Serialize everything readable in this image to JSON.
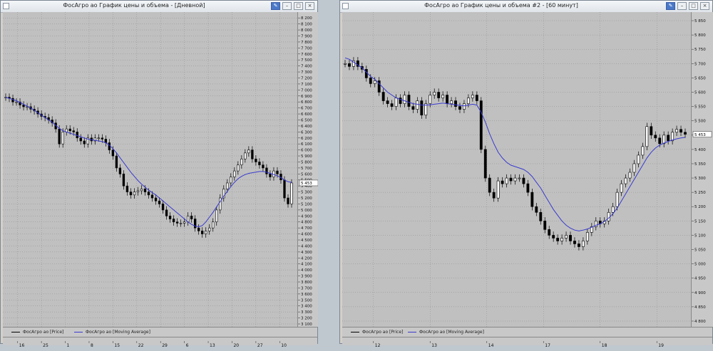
{
  "windows": [
    {
      "title": "ФосАгро ао График цены и объема - [Дневной]",
      "legend": [
        "ФосАгро ао [Price]",
        "ФосАгро ао [Moving Average]"
      ]
    },
    {
      "title": "ФосАгро ао График цены и объема #2 - [60 минут]",
      "legend": [
        "ФосАгро ао [Price]",
        "ФосАгро ао [Moving Average]"
      ]
    }
  ],
  "colors": {
    "price": "#000000",
    "moving_average": "#3a3ad0",
    "background": "#c0c0c0",
    "grid": "#8c8c8c"
  },
  "chart_data": [
    {
      "type": "line",
      "title": "ФосАгро ао График цены и объема - [Дневной]",
      "y_ticks": [
        3100,
        3200,
        3300,
        3400,
        3500,
        3600,
        3700,
        3800,
        3900,
        4000,
        4100,
        4200,
        4300,
        4400,
        4500,
        4600,
        4700,
        4800,
        4900,
        5000,
        5100,
        5200,
        5300,
        5400,
        5500,
        5600,
        5700,
        5800,
        5900,
        6000,
        6100,
        6200,
        6300,
        6400,
        6500,
        6600,
        6700,
        6800,
        6900,
        7000,
        7100,
        7200,
        7300,
        7400,
        7500,
        7600,
        7700,
        7800,
        7900,
        8000,
        8100,
        8200
      ],
      "ylim": [
        3100,
        8250
      ],
      "x_ticks": [
        "16",
        "25",
        "1",
        "8",
        "15",
        "22",
        "29",
        "6",
        "13",
        "20",
        "27",
        "10"
      ],
      "last_price_label": "5 453",
      "grid": true,
      "series": [
        {
          "name": "ФосАгро ао [Price]",
          "values": [
            6880,
            6860,
            6800,
            6800,
            6750,
            6720,
            6720,
            6680,
            6650,
            6600,
            6560,
            6540,
            6500,
            6450,
            6350,
            6100,
            6300,
            6350,
            6320,
            6300,
            6200,
            6150,
            6100,
            6200,
            6150,
            6200,
            6200,
            6180,
            6120,
            6000,
            5900,
            5700,
            5600,
            5400,
            5300,
            5250,
            5300,
            5320,
            5350,
            5300,
            5250,
            5200,
            5150,
            5100,
            5000,
            4900,
            4850,
            4800,
            4780,
            4780,
            4800,
            4900,
            4850,
            4700,
            4650,
            4600,
            4650,
            4700,
            4800,
            5000,
            5200,
            5350,
            5450,
            5550,
            5650,
            5750,
            5850,
            5950,
            6000,
            5850,
            5800,
            5750,
            5700,
            5600,
            5550,
            5650,
            5600,
            5500,
            5200,
            5100,
            5450
          ]
        },
        {
          "name": "ФосАгро ао [Moving Average]",
          "values": [
            6880,
            6860,
            6840,
            6820,
            6790,
            6760,
            6730,
            6700,
            6660,
            6620,
            6580,
            6540,
            6500,
            6460,
            6410,
            6360,
            6320,
            6300,
            6280,
            6260,
            6240,
            6220,
            6200,
            6180,
            6170,
            6160,
            6150,
            6140,
            6120,
            6080,
            6020,
            5950,
            5870,
            5790,
            5710,
            5630,
            5560,
            5490,
            5430,
            5380,
            5330,
            5290,
            5250,
            5200,
            5150,
            5100,
            5050,
            5000,
            4950,
            4900,
            4850,
            4800,
            4760,
            4730,
            4720,
            4740,
            4800,
            4880,
            4960,
            5050,
            5140,
            5230,
            5310,
            5390,
            5460,
            5520,
            5560,
            5590,
            5610,
            5620,
            5630,
            5640,
            5640,
            5630,
            5610,
            5590,
            5570,
            5540,
            5500,
            5470,
            5460
          ]
        }
      ]
    },
    {
      "type": "line",
      "title": "ФосАгро ао График цены и объема #2 - [60 минут]",
      "y_ticks": [
        4800,
        4850,
        4900,
        4950,
        5000,
        5050,
        5100,
        5150,
        5200,
        5250,
        5300,
        5350,
        5400,
        5450,
        5500,
        5550,
        5600,
        5650,
        5700,
        5750,
        5800,
        5850
      ],
      "ylim": [
        4790,
        5870
      ],
      "x_ticks": [
        "12",
        "13",
        "14",
        "17",
        "18",
        "19"
      ],
      "last_price_label": "5 453",
      "grid": true,
      "series": [
        {
          "name": "ФосАгро ао [Price]",
          "values": [
            5700,
            5690,
            5710,
            5690,
            5680,
            5650,
            5630,
            5640,
            5600,
            5570,
            5560,
            5550,
            5580,
            5560,
            5590,
            5550,
            5540,
            5570,
            5520,
            5560,
            5590,
            5600,
            5580,
            5590,
            5560,
            5570,
            5550,
            5540,
            5560,
            5580,
            5590,
            5570,
            5400,
            5300,
            5250,
            5230,
            5290,
            5280,
            5300,
            5290,
            5300,
            5300,
            5280,
            5250,
            5200,
            5180,
            5150,
            5120,
            5100,
            5090,
            5080,
            5090,
            5100,
            5080,
            5070,
            5060,
            5080,
            5110,
            5130,
            5150,
            5140,
            5150,
            5180,
            5200,
            5250,
            5280,
            5300,
            5320,
            5350,
            5380,
            5410,
            5480,
            5450,
            5440,
            5420,
            5450,
            5430,
            5460,
            5470,
            5460,
            5453
          ]
        },
        {
          "name": "ФосАгро ао [Moving Average]",
          "values": [
            5720,
            5715,
            5705,
            5695,
            5685,
            5670,
            5655,
            5645,
            5630,
            5615,
            5600,
            5590,
            5580,
            5575,
            5570,
            5565,
            5560,
            5558,
            5555,
            5555,
            5556,
            5558,
            5560,
            5562,
            5560,
            5558,
            5556,
            5554,
            5552,
            5555,
            5558,
            5555,
            5530,
            5495,
            5455,
            5420,
            5390,
            5370,
            5355,
            5345,
            5340,
            5335,
            5330,
            5320,
            5305,
            5285,
            5265,
            5240,
            5215,
            5190,
            5170,
            5150,
            5135,
            5125,
            5118,
            5115,
            5118,
            5122,
            5128,
            5135,
            5140,
            5148,
            5160,
            5175,
            5195,
            5220,
            5245,
            5270,
            5295,
            5320,
            5345,
            5370,
            5390,
            5405,
            5415,
            5422,
            5428,
            5433,
            5437,
            5440,
            5442
          ]
        }
      ]
    }
  ]
}
